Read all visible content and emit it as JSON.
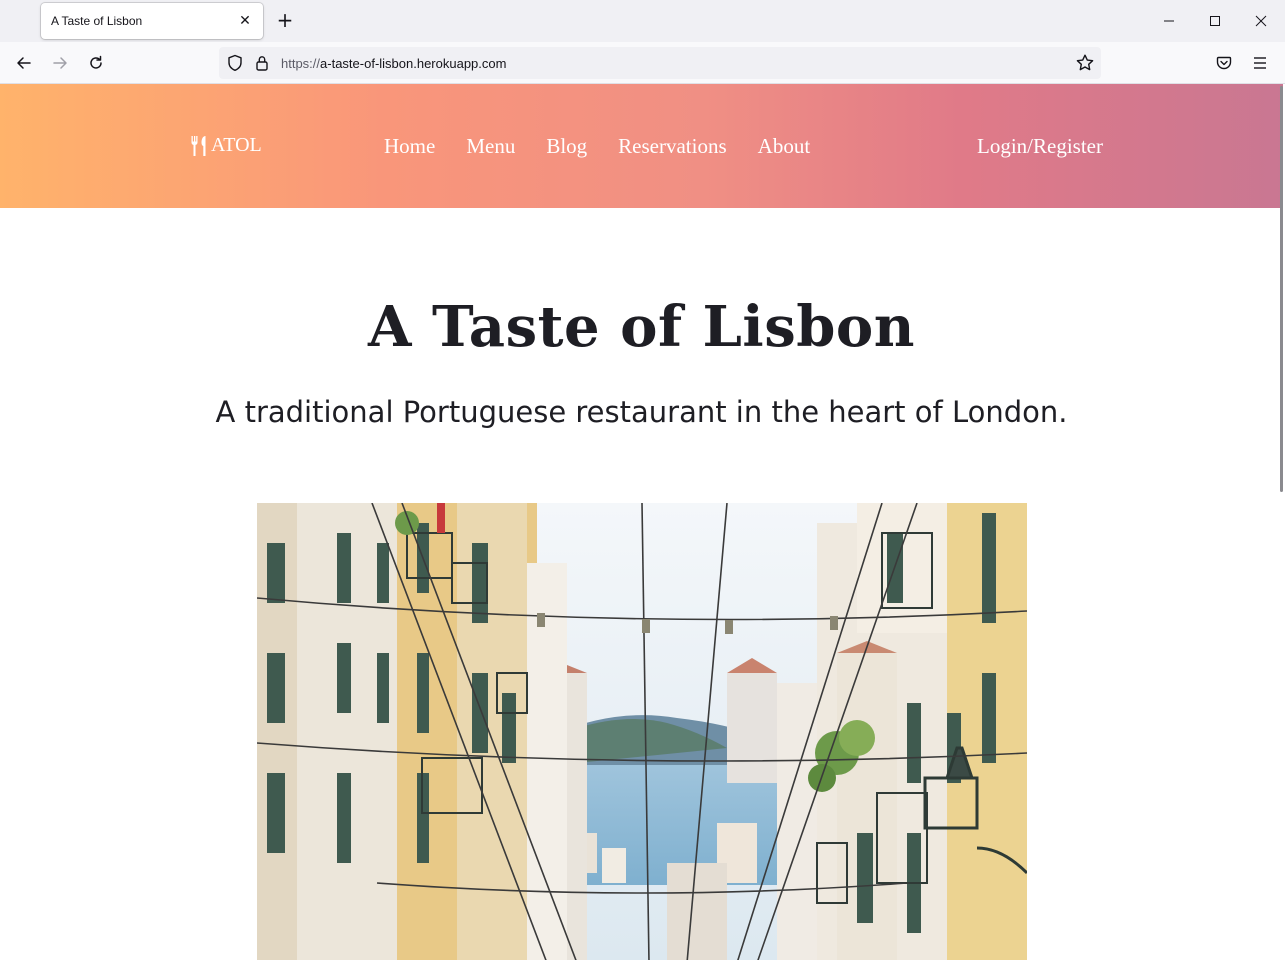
{
  "browser": {
    "tab": {
      "title": "A Taste of Lisbon",
      "close_icon": "close-icon"
    },
    "url": {
      "protocol": "https://",
      "host": "a-taste-of-lisbon.herokuapp.com"
    }
  },
  "site": {
    "brand": "ATOL",
    "nav": [
      {
        "label": "Home"
      },
      {
        "label": "Menu"
      },
      {
        "label": "Blog"
      },
      {
        "label": "Reservations"
      },
      {
        "label": "About"
      }
    ],
    "login_label": "Login/Register",
    "header_gradient": [
      "#ffb36b",
      "#f9967a",
      "#e07a88",
      "#c97792"
    ]
  },
  "hero": {
    "title": "A Taste of Lisbon",
    "subtitle": "A traditional Portuguese restaurant in the heart of London.",
    "image_subject": "Lisbon street with tram wires and river view"
  }
}
